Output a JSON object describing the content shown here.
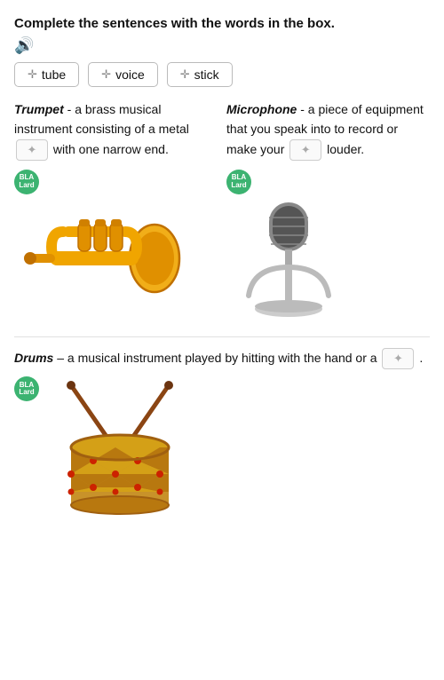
{
  "instruction": "Complete the sentences with the words in the box.",
  "words": [
    {
      "id": "tube",
      "label": "tube"
    },
    {
      "id": "voice",
      "label": "voice"
    },
    {
      "id": "stick",
      "label": "stick"
    }
  ],
  "entries": [
    {
      "term": "Trumpet",
      "definition_parts": [
        "- a brass musical instrument consisting of a metal",
        "with one narrow end."
      ],
      "drop_position": 1
    },
    {
      "term": "Microphone",
      "definition_parts": [
        "- a piece of equipment that you speak into to record or make your",
        "louder."
      ],
      "drop_position": 1
    }
  ],
  "drums": {
    "term": "Drums",
    "definition": "– a musical instrument played by hitting with the hand or a",
    "end": "."
  },
  "audio_badge_text": "BLA\nLard",
  "colors": {
    "green_badge": "#3cb371",
    "chip_border": "#bbb",
    "term_color": "#111"
  }
}
